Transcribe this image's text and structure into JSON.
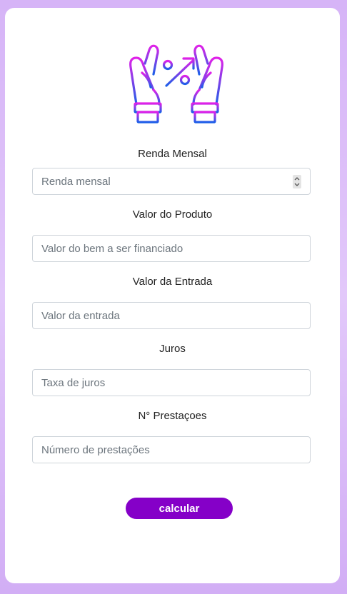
{
  "form": {
    "fields": [
      {
        "label": "Renda Mensal",
        "placeholder": "Renda mensal",
        "value": ""
      },
      {
        "label": "Valor do Produto",
        "placeholder": "Valor do bem a ser financiado",
        "value": ""
      },
      {
        "label": "Valor da Entrada",
        "placeholder": "Valor da entrada",
        "value": ""
      },
      {
        "label": "Juros",
        "placeholder": "Taxa de juros",
        "value": ""
      },
      {
        "label": "N° Prestaçoes",
        "placeholder": "Número de prestações",
        "value": ""
      }
    ],
    "submit_label": "calcular"
  },
  "logo": {
    "icon": "hands-percent-growth-icon",
    "gradient_start": "#e021e8",
    "gradient_end": "#1d5fe8"
  },
  "colors": {
    "background": "#d9bcf8",
    "card": "#ffffff",
    "button": "#8500c8",
    "button_text": "#ffffff",
    "input_border": "#ced4da",
    "placeholder": "#6c757d"
  }
}
